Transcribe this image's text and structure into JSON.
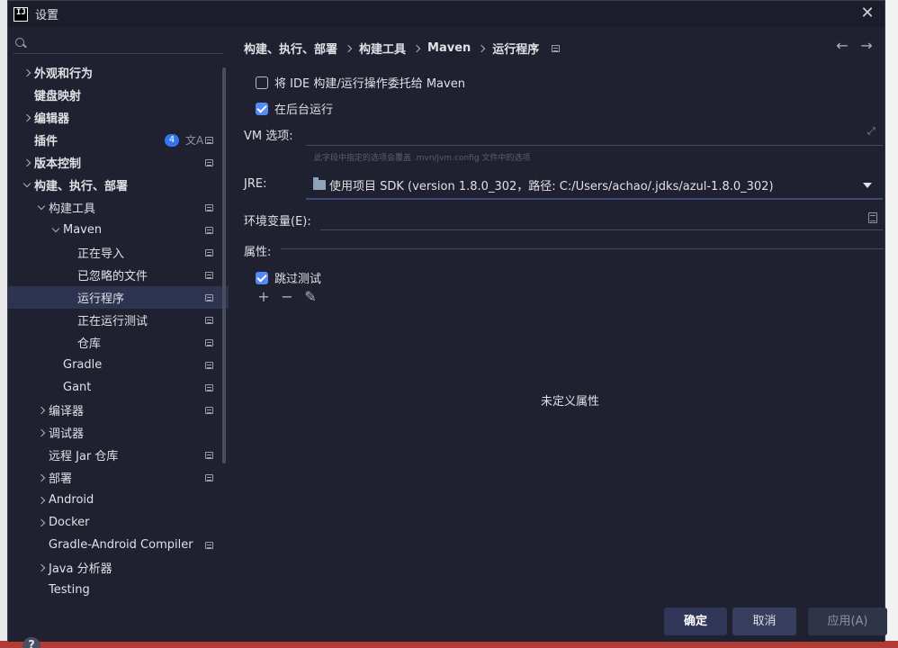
{
  "window": {
    "title": "设置",
    "logo_text": "IJ",
    "close_glyph": "✕"
  },
  "search": {
    "placeholder": "",
    "value": ""
  },
  "sidebar": {
    "items": [
      {
        "label": "外观和行为",
        "chevron": "right",
        "indent": 0,
        "bold": true
      },
      {
        "label": "键盘映射",
        "chevron": "none",
        "indent": 0,
        "bold": true
      },
      {
        "label": "编辑器",
        "chevron": "right",
        "indent": 0,
        "bold": true
      },
      {
        "label": "插件",
        "chevron": "none",
        "indent": 0,
        "bold": true,
        "badge": "4",
        "translate_icon": "文A",
        "settings_icon": true
      },
      {
        "label": "版本控制",
        "chevron": "right",
        "indent": 0,
        "bold": true,
        "settings_icon": true
      },
      {
        "label": "构建、执行、部署",
        "chevron": "down",
        "indent": 0,
        "bold": true
      },
      {
        "label": "构建工具",
        "chevron": "down",
        "indent": 1,
        "settings_icon": true
      },
      {
        "label": "Maven",
        "chevron": "down",
        "indent": 2,
        "settings_icon": true
      },
      {
        "label": "正在导入",
        "chevron": "none",
        "indent": 3,
        "settings_icon": true
      },
      {
        "label": "已忽略的文件",
        "chevron": "none",
        "indent": 3,
        "settings_icon": true
      },
      {
        "label": "运行程序",
        "chevron": "none",
        "indent": 3,
        "settings_icon": true,
        "selected": true
      },
      {
        "label": "正在运行测试",
        "chevron": "none",
        "indent": 3,
        "settings_icon": true
      },
      {
        "label": "仓库",
        "chevron": "none",
        "indent": 3,
        "settings_icon": true
      },
      {
        "label": "Gradle",
        "chevron": "none",
        "indent": 2,
        "settings_icon": true
      },
      {
        "label": "Gant",
        "chevron": "none",
        "indent": 2,
        "settings_icon": true
      },
      {
        "label": "编译器",
        "chevron": "right",
        "indent": 1,
        "settings_icon": true
      },
      {
        "label": "调试器",
        "chevron": "right",
        "indent": 1
      },
      {
        "label": "远程 Jar 仓库",
        "chevron": "none",
        "indent": 1,
        "settings_icon": true
      },
      {
        "label": "部署",
        "chevron": "right",
        "indent": 1,
        "settings_icon": true
      },
      {
        "label": "Android",
        "chevron": "right",
        "indent": 1
      },
      {
        "label": "Docker",
        "chevron": "right",
        "indent": 1
      },
      {
        "label": "Gradle-Android Compiler",
        "chevron": "none",
        "indent": 1,
        "settings_icon": true
      },
      {
        "label": "Java 分析器",
        "chevron": "right",
        "indent": 1
      },
      {
        "label": "Testing",
        "chevron": "none",
        "indent": 1
      }
    ]
  },
  "breadcrumb": {
    "items": [
      "构建、执行、部署",
      "构建工具",
      "Maven",
      "运行程序"
    ]
  },
  "nav": {
    "back": "←",
    "forward": "→"
  },
  "options": {
    "delegate_label": "将 IDE 构建/运行操作委托给 Maven",
    "delegate_checked": false,
    "background_label": "在后台运行",
    "background_checked": true,
    "vm_label": "VM 选项:",
    "vm_value": "",
    "vm_hint": "此字段中指定的选项会覆盖 .mvn/jvm.config 文件中的选项",
    "jre_label": "JRE:",
    "jre_value": "使用项目 SDK (version 1.8.0_302，路径: C:/Users/achao/.jdks/azul-1.8.0_302)",
    "env_label": "环境变量(E):",
    "env_value": "",
    "properties_label": "属性:",
    "skip_tests_label": "跳过测试",
    "skip_tests_checked": true,
    "empty_properties": "未定义属性"
  },
  "toolbar": {
    "add": "+",
    "remove": "−",
    "edit": "✎"
  },
  "footer": {
    "help": "?",
    "ok": "确定",
    "cancel": "取消",
    "apply": "应用(A)"
  },
  "colors": {
    "accent": "#548af7",
    "badge": "#3574f0",
    "background": "#1f2131"
  }
}
